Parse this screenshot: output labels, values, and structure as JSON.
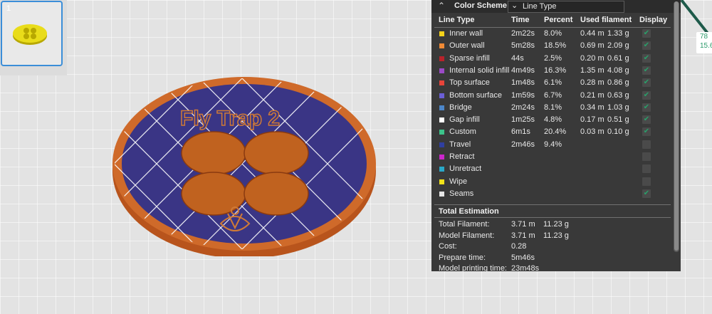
{
  "plate": {
    "number": "1"
  },
  "model": {
    "text": "Fly Trap 2"
  },
  "color_scheme": {
    "title": "Color Scheme",
    "selected": "Line Type",
    "columns": [
      "Line Type",
      "Time",
      "Percent",
      "Used filament",
      "Display"
    ],
    "rows": [
      {
        "name": "Inner wall",
        "color": "#f5d21a",
        "time": "2m22s",
        "percent": "8.0%",
        "length": "0.44 m",
        "weight": "1.33 g",
        "display": true
      },
      {
        "name": "Outer wall",
        "color": "#f08a35",
        "time": "5m28s",
        "percent": "18.5%",
        "length": "0.69 m",
        "weight": "2.09 g",
        "display": true
      },
      {
        "name": "Sparse infill",
        "color": "#b8232b",
        "time": "44s",
        "percent": "2.5%",
        "length": "0.20 m",
        "weight": "0.61 g",
        "display": true
      },
      {
        "name": "Internal solid infill",
        "color": "#9b4ac7",
        "time": "4m49s",
        "percent": "16.3%",
        "length": "1.35 m",
        "weight": "4.08 g",
        "display": true
      },
      {
        "name": "Top surface",
        "color": "#e8443a",
        "time": "1m48s",
        "percent": "6.1%",
        "length": "0.28 m",
        "weight": "0.86 g",
        "display": true
      },
      {
        "name": "Bottom surface",
        "color": "#6b5fd6",
        "time": "1m59s",
        "percent": "6.7%",
        "length": "0.21 m",
        "weight": "0.63 g",
        "display": true
      },
      {
        "name": "Bridge",
        "color": "#4c86c9",
        "time": "2m24s",
        "percent": "8.1%",
        "length": "0.34 m",
        "weight": "1.03 g",
        "display": true
      },
      {
        "name": "Gap infill",
        "color": "#ffffff",
        "time": "1m25s",
        "percent": "4.8%",
        "length": "0.17 m",
        "weight": "0.51 g",
        "display": true
      },
      {
        "name": "Custom",
        "color": "#3cc38a",
        "time": "6m1s",
        "percent": "20.4%",
        "length": "0.03 m",
        "weight": "0.10 g",
        "display": true
      },
      {
        "name": "Travel",
        "color": "#2f3fa0",
        "time": "2m46s",
        "percent": "9.4%",
        "length": "",
        "weight": "",
        "display": false
      },
      {
        "name": "Retract",
        "color": "#cc27cc",
        "time": "",
        "percent": "",
        "length": "",
        "weight": "",
        "display": false
      },
      {
        "name": "Unretract",
        "color": "#2aa8c8",
        "time": "",
        "percent": "",
        "length": "",
        "weight": "",
        "display": false
      },
      {
        "name": "Wipe",
        "color": "#f2e21a",
        "time": "",
        "percent": "",
        "length": "",
        "weight": "",
        "display": false
      },
      {
        "name": "Seams",
        "color": "#e6e6e6",
        "time": "",
        "percent": "",
        "length": "",
        "weight": "",
        "display": true
      }
    ],
    "total_title": "Total Estimation",
    "estimation": [
      {
        "label": "Total Filament:",
        "v1": "3.71 m",
        "v2": "11.23 g"
      },
      {
        "label": "Model Filament:",
        "v1": "3.71 m",
        "v2": "11.23 g"
      },
      {
        "label": "Cost:",
        "v1": "0.28",
        "v2": ""
      },
      {
        "label": "Prepare time:",
        "v1": "5m46s",
        "v2": ""
      },
      {
        "label": "Model printing time:",
        "v1": "23m48s",
        "v2": ""
      }
    ]
  },
  "ruler": {
    "line1": "78",
    "line2": "15.6"
  },
  "icons": {
    "collapse": "collapse-up-icon",
    "dropdown": "chevron-down-icon",
    "check": "checkmark-icon"
  }
}
